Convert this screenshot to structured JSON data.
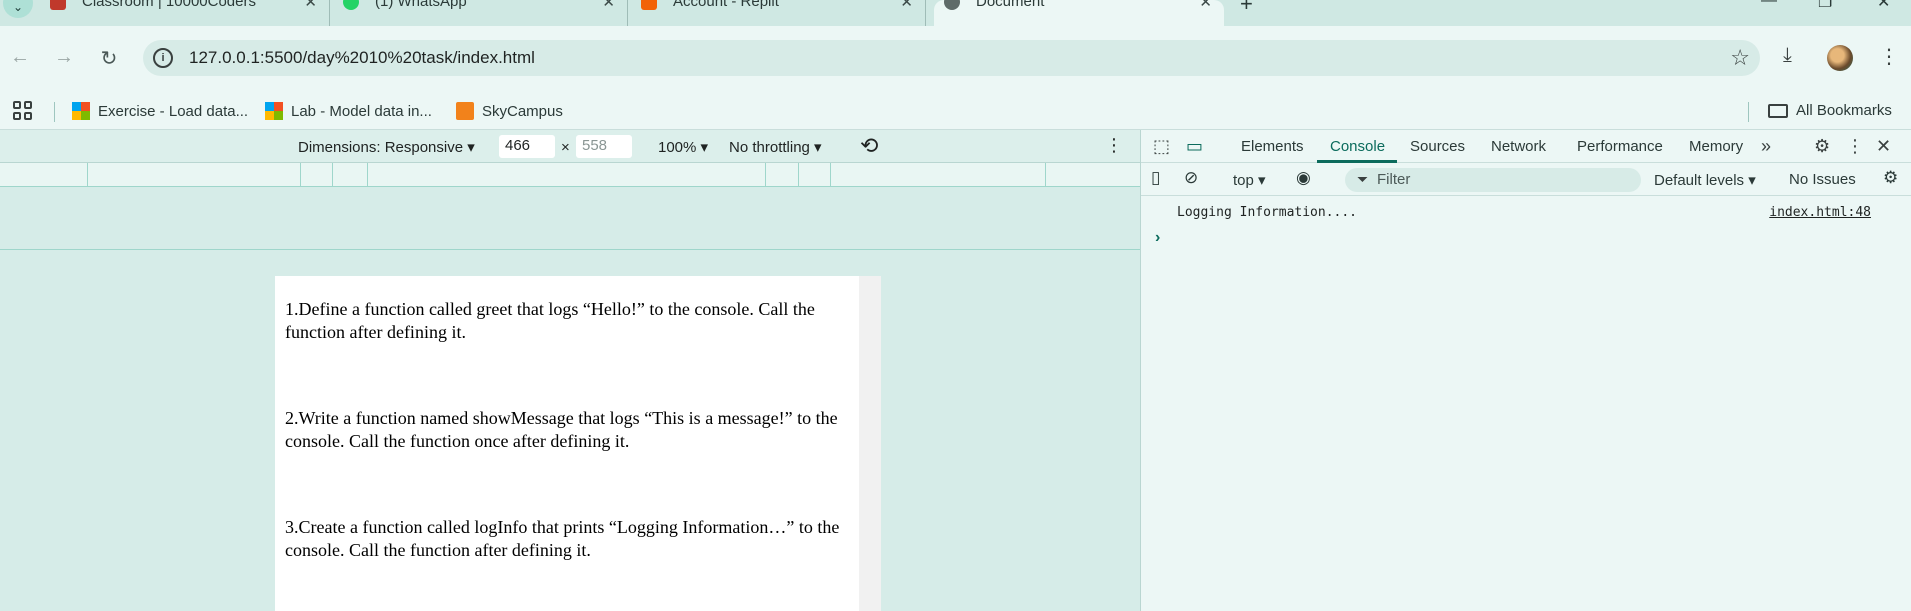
{
  "tabs": [
    {
      "title": "Classroom | 10000Coders",
      "icon": "classroom-favicon-icon"
    },
    {
      "title": "(1) WhatsApp",
      "icon": "whatsapp-favicon-icon"
    },
    {
      "title": "Account - Replit",
      "icon": "replit-favicon-icon"
    },
    {
      "title": "Document",
      "icon": "globe-favicon-icon",
      "active": true
    }
  ],
  "toolbar": {
    "url": "127.0.0.1:5500/day%2010%20task/index.html"
  },
  "bookmarks": {
    "items": [
      {
        "label": "Exercise - Load data..."
      },
      {
        "label": "Lab - Model data in..."
      },
      {
        "label": "SkyCampus"
      }
    ],
    "all_label": "All Bookmarks"
  },
  "device_toolbar": {
    "dimensions": "Dimensions: Responsive",
    "width": "466",
    "height_placeholder": "558",
    "times": "×",
    "zoom": "100%",
    "throttling": "No throttling"
  },
  "page": {
    "tasks": [
      "1.Define a function called greet that logs “Hello!” to the console. Call the function after defining it.",
      "2.Write a function named showMessage that logs “This is a message!” to the console. Call the function once after defining it.",
      "3.Create a function called logInfo that prints “Logging Information…” to the console. Call the function after defining it."
    ]
  },
  "devtools": {
    "tabs": [
      "Elements",
      "Console",
      "Sources",
      "Network",
      "Performance",
      "Memory"
    ],
    "active_tab": "Console",
    "context": "top",
    "filter_placeholder": "Filter",
    "levels": "Default levels",
    "issues": "No Issues",
    "log_message": "Logging Information....",
    "log_source": "index.html:48",
    "accent": "#0b6b5c"
  }
}
